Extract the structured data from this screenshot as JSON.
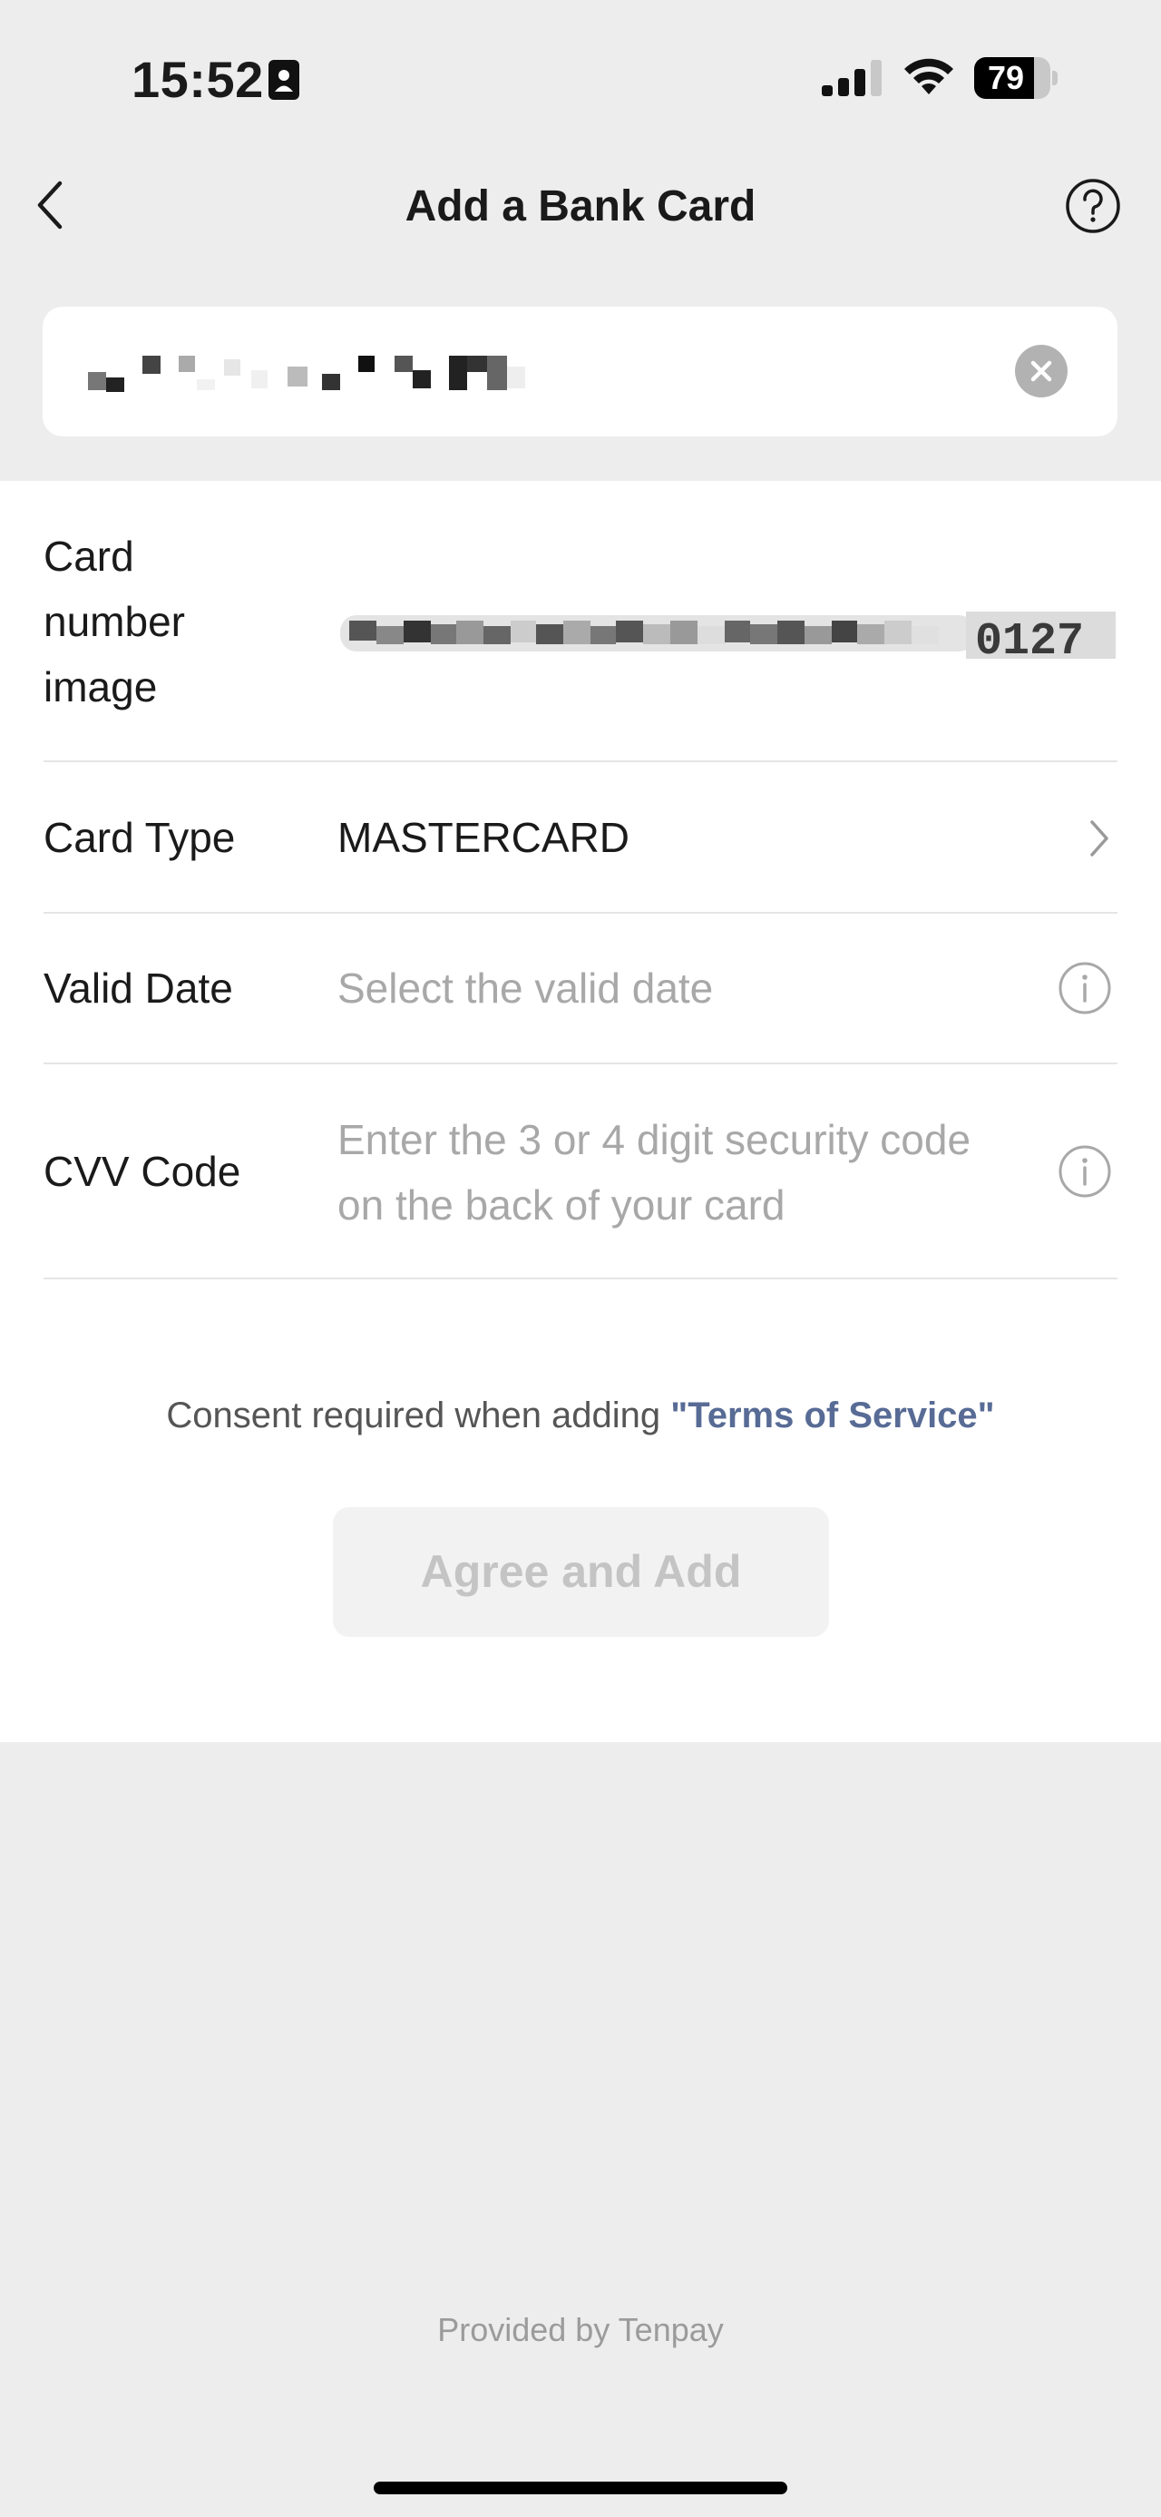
{
  "status_bar": {
    "time": "15:52",
    "battery_percent": "79",
    "battery_level": 0.79,
    "icons": [
      "contact-card-icon",
      "signal-icon",
      "wifi-icon",
      "battery-icon"
    ]
  },
  "nav": {
    "title": "Add a Bank Card",
    "back_icon": "chevron-left-icon",
    "help_icon": "question-circle-icon"
  },
  "card_number_input": {
    "value_masked": true,
    "clear_icon": "clear-icon"
  },
  "form": {
    "card_image": {
      "label": "Card number image",
      "visible_digits": "0127"
    },
    "card_type": {
      "label": "Card Type",
      "value": "MASTERCARD"
    },
    "valid_date": {
      "label": "Valid Date",
      "placeholder": "Select the valid date"
    },
    "cvv": {
      "label": "CVV Code",
      "placeholder": "Enter the 3 or 4 digit security code on the back of your card"
    }
  },
  "consent": {
    "text": "Consent required when adding",
    "link": "\"Terms of Service\""
  },
  "agree_button": {
    "label": "Agree and Add"
  },
  "footer": {
    "text": "Provided by Tenpay"
  },
  "colors": {
    "background": "#ededed",
    "panel": "#ffffff",
    "link": "#576b95",
    "placeholder": "#a8a8a8",
    "disabled_text": "#c4c4c4"
  }
}
